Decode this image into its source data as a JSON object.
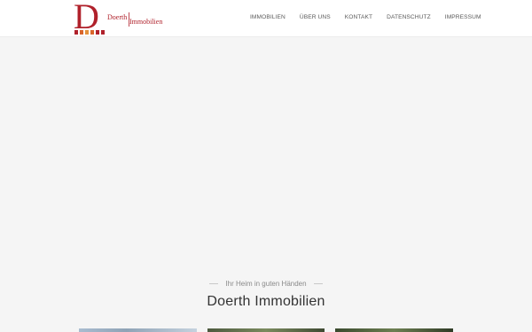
{
  "brand": {
    "logo_letter": "D",
    "logo_line1": "Doerth",
    "logo_line2": "Immobilien",
    "color": "#b0212b"
  },
  "nav": {
    "items": [
      {
        "label": "IMMOBILIEN"
      },
      {
        "label": "ÜBER UNS"
      },
      {
        "label": "KONTAKT"
      },
      {
        "label": "DATENSCHUTZ"
      },
      {
        "label": "IMPRESSUM"
      }
    ]
  },
  "section": {
    "tagline": "Ihr Heim in guten Händen",
    "title": "Doerth Immobilien"
  }
}
